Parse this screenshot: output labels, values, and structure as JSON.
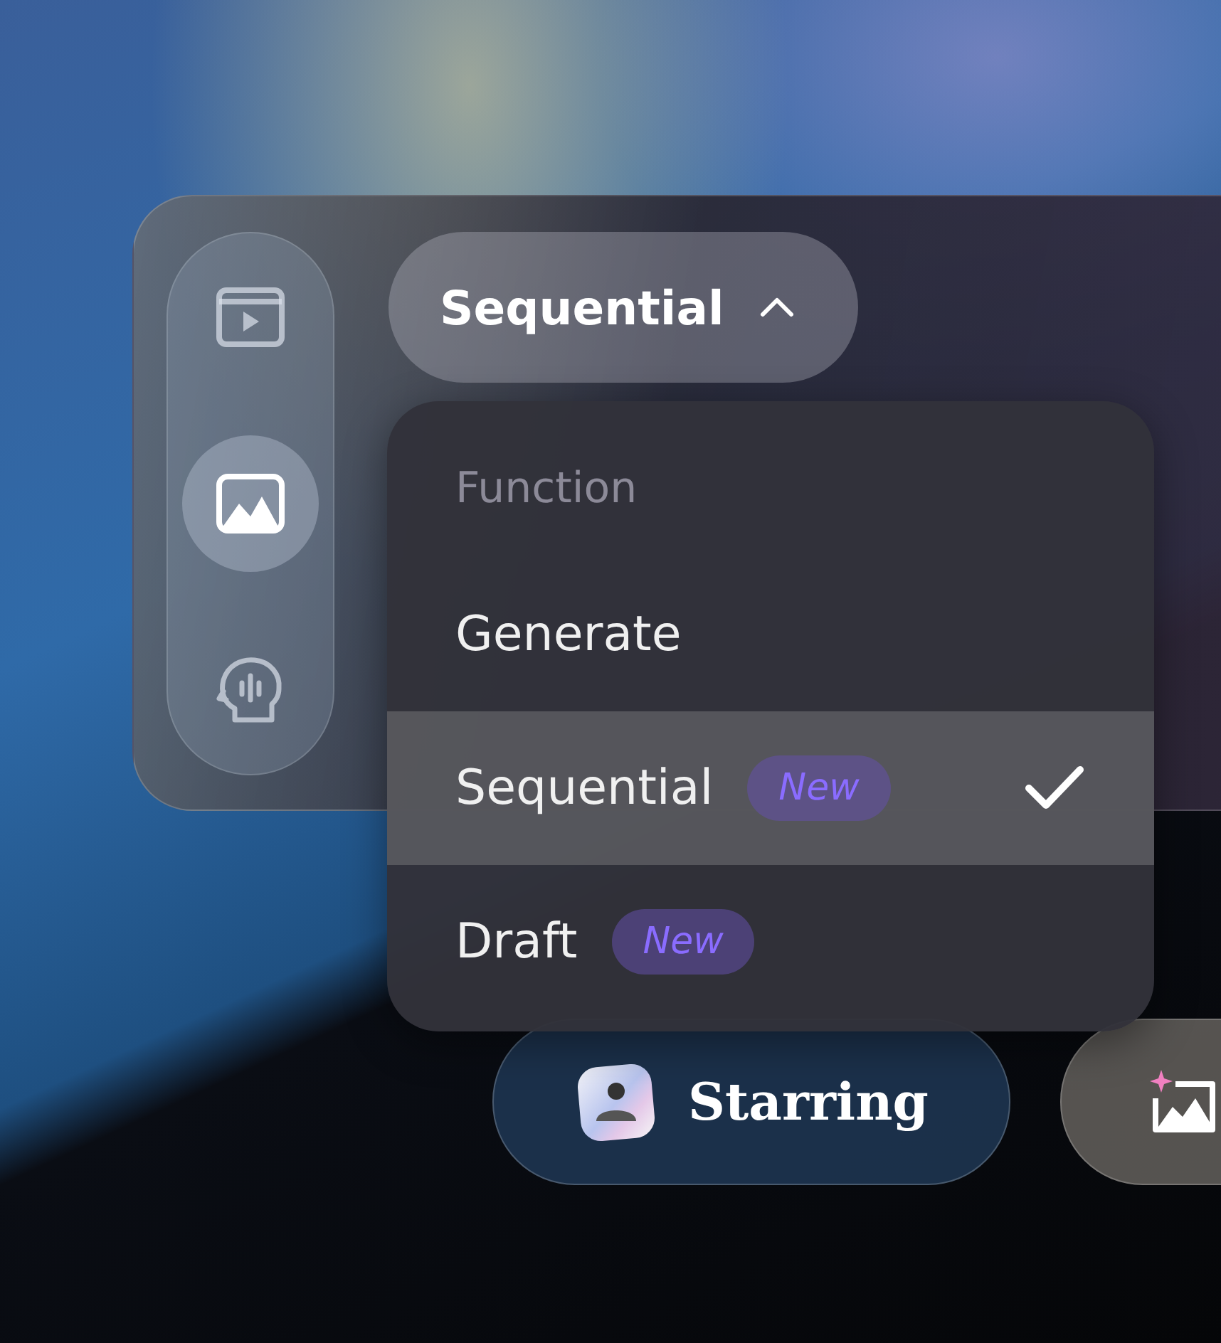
{
  "sidebar": {
    "items": [
      {
        "kind": "video",
        "selected": false
      },
      {
        "kind": "image",
        "selected": true
      },
      {
        "kind": "voice",
        "selected": false
      }
    ]
  },
  "mode_button": {
    "label": "Sequential",
    "expanded": true
  },
  "dropdown": {
    "heading": "Function",
    "items": [
      {
        "label": "Generate",
        "selected": false
      },
      {
        "label": "Sequential",
        "badge": "New",
        "selected": true
      },
      {
        "label": "Draft",
        "badge": "New",
        "selected": false
      }
    ]
  },
  "chips": [
    {
      "kind": "starring",
      "label": "Starring"
    },
    {
      "kind": "image"
    }
  ]
}
